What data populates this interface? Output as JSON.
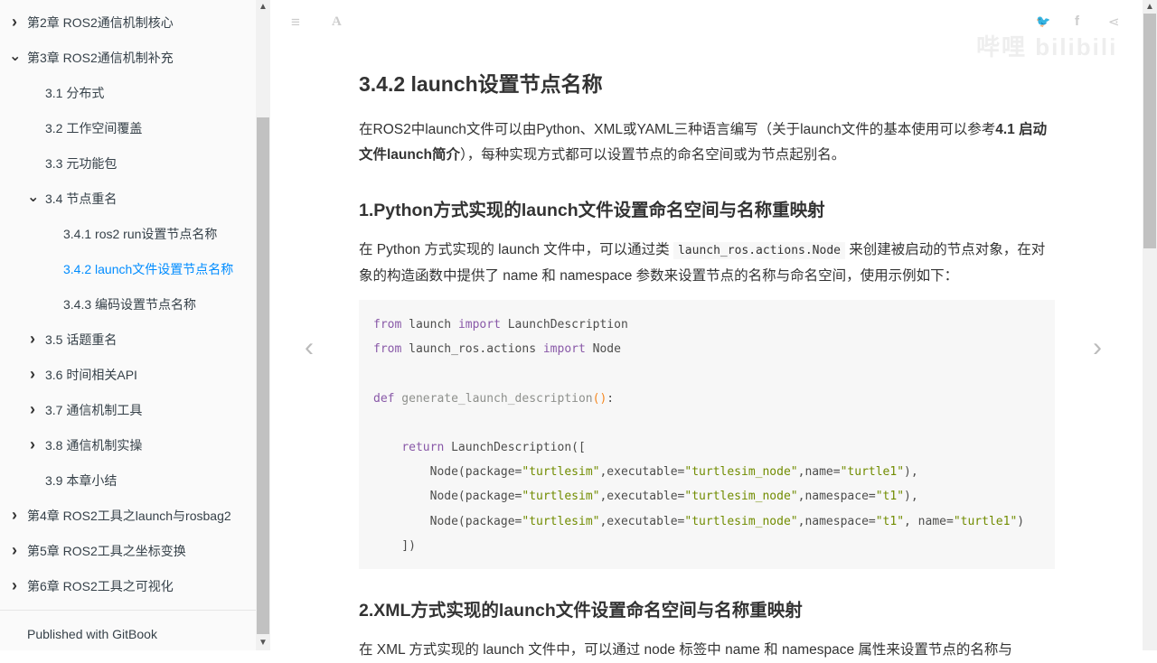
{
  "sidebar": {
    "items": [
      {
        "label": "第2章 ROS2通信机制核心",
        "level": 1,
        "arrow": "right"
      },
      {
        "label": "第3章 ROS2通信机制补充",
        "level": 1,
        "arrow": "down"
      },
      {
        "label": "3.1 分布式",
        "level": 2,
        "arrow": ""
      },
      {
        "label": "3.2 工作空间覆盖",
        "level": 2,
        "arrow": ""
      },
      {
        "label": "3.3 元功能包",
        "level": 2,
        "arrow": ""
      },
      {
        "label": "3.4 节点重名",
        "level": 2,
        "arrow": "down"
      },
      {
        "label": "3.4.1 ros2 run设置节点名称",
        "level": 3,
        "arrow": ""
      },
      {
        "label": "3.4.2 launch文件设置节点名称",
        "level": 3,
        "arrow": "",
        "active": true
      },
      {
        "label": "3.4.3 编码设置节点名称",
        "level": 3,
        "arrow": ""
      },
      {
        "label": "3.5 话题重名",
        "level": 2,
        "arrow": "right"
      },
      {
        "label": "3.6 时间相关API",
        "level": 2,
        "arrow": "right"
      },
      {
        "label": "3.7 通信机制工具",
        "level": 2,
        "arrow": "right"
      },
      {
        "label": "3.8 通信机制实操",
        "level": 2,
        "arrow": "right"
      },
      {
        "label": "3.9 本章小结",
        "level": 2,
        "arrow": ""
      },
      {
        "label": "第4章 ROS2工具之launch与rosbag2",
        "level": 1,
        "arrow": "right"
      },
      {
        "label": "第5章 ROS2工具之坐标变换",
        "level": 1,
        "arrow": "right"
      },
      {
        "label": "第6章 ROS2工具之可视化",
        "level": 1,
        "arrow": "right"
      }
    ],
    "footer": "Published with GitBook"
  },
  "header": {
    "icons": [
      "menu-icon",
      "font-settings-icon",
      "twitter-icon",
      "facebook-icon",
      "share-icon"
    ],
    "watermark": "bilibili"
  },
  "article": {
    "title": "3.4.2 launch设置节点名称",
    "intro": {
      "before": "在ROS2中launch文件可以由Python、XML或YAML三种语言编写（关于launch文件的基本使用可以参考",
      "link": "4.1 启动文件launch简介",
      "after": "），每种实现方式都可以设置节点的命名空间或为节点起别名。"
    },
    "h1": "1.Python方式实现的launch文件设置命名空间与名称重映射",
    "p1": {
      "before": "在 Python 方式实现的 launch 文件中，可以通过类 ",
      "code": "launch_ros.actions.Node",
      "after": " 来创建被启动的节点对象，在对象的构造函数中提供了 name 和 namespace 参数来设置节点的名称与命名空间，使用示例如下："
    },
    "code": [
      [
        [
          "kw",
          "from"
        ],
        [
          "plain",
          " launch "
        ],
        [
          "kw",
          "import"
        ],
        [
          "plain",
          " LaunchDescription"
        ]
      ],
      [
        [
          "kw",
          "from"
        ],
        [
          "plain",
          " launch_ros.actions "
        ],
        [
          "kw",
          "import"
        ],
        [
          "plain",
          " Node"
        ]
      ],
      [],
      [
        [
          "kw",
          "def"
        ],
        [
          "fn",
          " generate_launch_description"
        ],
        [
          "paren",
          "()"
        ],
        [
          "plain",
          ":"
        ]
      ],
      [],
      [
        [
          "plain",
          "    "
        ],
        [
          "kw",
          "return"
        ],
        [
          "plain",
          " LaunchDescription(["
        ]
      ],
      [
        [
          "plain",
          "        Node(package="
        ],
        [
          "str",
          "\"turtlesim\""
        ],
        [
          "plain",
          ",executable="
        ],
        [
          "str",
          "\"turtlesim_node\""
        ],
        [
          "plain",
          ",name="
        ],
        [
          "str",
          "\"turtle1\""
        ],
        [
          "plain",
          "),"
        ]
      ],
      [
        [
          "plain",
          "        Node(package="
        ],
        [
          "str",
          "\"turtlesim\""
        ],
        [
          "plain",
          ",executable="
        ],
        [
          "str",
          "\"turtlesim_node\""
        ],
        [
          "plain",
          ",namespace="
        ],
        [
          "str",
          "\"t1\""
        ],
        [
          "plain",
          "),"
        ]
      ],
      [
        [
          "plain",
          "        Node(package="
        ],
        [
          "str",
          "\"turtlesim\""
        ],
        [
          "plain",
          ",executable="
        ],
        [
          "str",
          "\"turtlesim_node\""
        ],
        [
          "plain",
          ",namespace="
        ],
        [
          "str",
          "\"t1\""
        ],
        [
          "plain",
          ", name="
        ],
        [
          "str",
          "\"turtle1\""
        ],
        [
          "plain",
          ")"
        ]
      ],
      [
        [
          "plain",
          "    ])"
        ]
      ]
    ],
    "h2": "2.XML方式实现的launch文件设置命名空间与名称重映射",
    "p2": "在 XML 方式实现的 launch 文件中，可以通过 node 标签中 name 和 namespace 属性来设置节点的名称与"
  },
  "nav": {
    "prev": "‹",
    "next": "›"
  }
}
